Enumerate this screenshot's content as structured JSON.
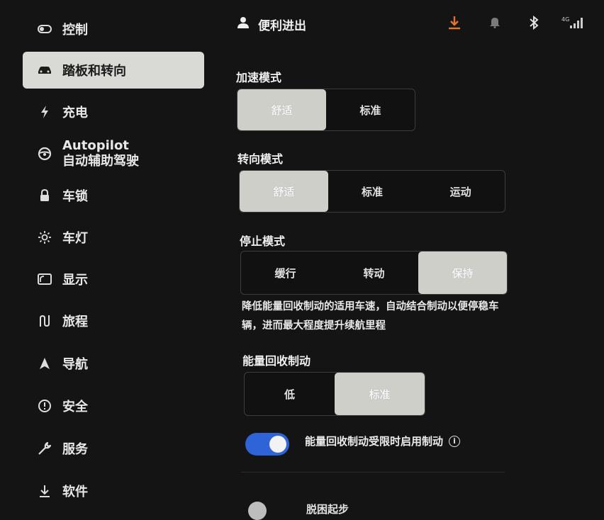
{
  "sidebar": {
    "items": [
      {
        "label": "控制",
        "icon": "toggle-icon"
      },
      {
        "label": "踏板和转向",
        "icon": "car-icon",
        "active": true
      },
      {
        "label": "充电",
        "icon": "bolt-icon"
      },
      {
        "label": "Autopilot",
        "sublabel": "自动辅助驾驶",
        "icon": "steering-wheel-icon"
      },
      {
        "label": "车锁",
        "icon": "lock-icon"
      },
      {
        "label": "车灯",
        "icon": "sun-icon"
      },
      {
        "label": "显示",
        "icon": "display-icon"
      },
      {
        "label": "旅程",
        "icon": "route-icon"
      },
      {
        "label": "导航",
        "icon": "navigation-icon"
      },
      {
        "label": "安全",
        "icon": "alert-circle-icon"
      },
      {
        "label": "服务",
        "icon": "wrench-icon"
      },
      {
        "label": "软件",
        "icon": "download-icon"
      }
    ]
  },
  "header": {
    "title": "便利进出",
    "status_colors": {
      "download": "#e2752b",
      "default": "#cfcfcf"
    }
  },
  "acceleration": {
    "label": "加速模式",
    "options": [
      "舒适",
      "标准"
    ],
    "selected": 0
  },
  "steering": {
    "label": "转向模式",
    "options": [
      "舒适",
      "标准",
      "运动"
    ],
    "selected": 0
  },
  "stop_mode": {
    "label": "停止模式",
    "options": [
      "缓行",
      "转动",
      "保持"
    ],
    "selected": 2,
    "description": "降低能量回收制动的适用车速，自动结合制动以便停稳车辆，进而最大程度提升续航里程"
  },
  "regen": {
    "label": "能量回收制动",
    "options": [
      "低",
      "标准"
    ],
    "selected": 1
  },
  "regen_toggle": {
    "label": "能量回收制动受限时启用制动",
    "on": true,
    "accent": "#2f63d8"
  },
  "bottom_toggle": {
    "label": "脱困起步"
  }
}
